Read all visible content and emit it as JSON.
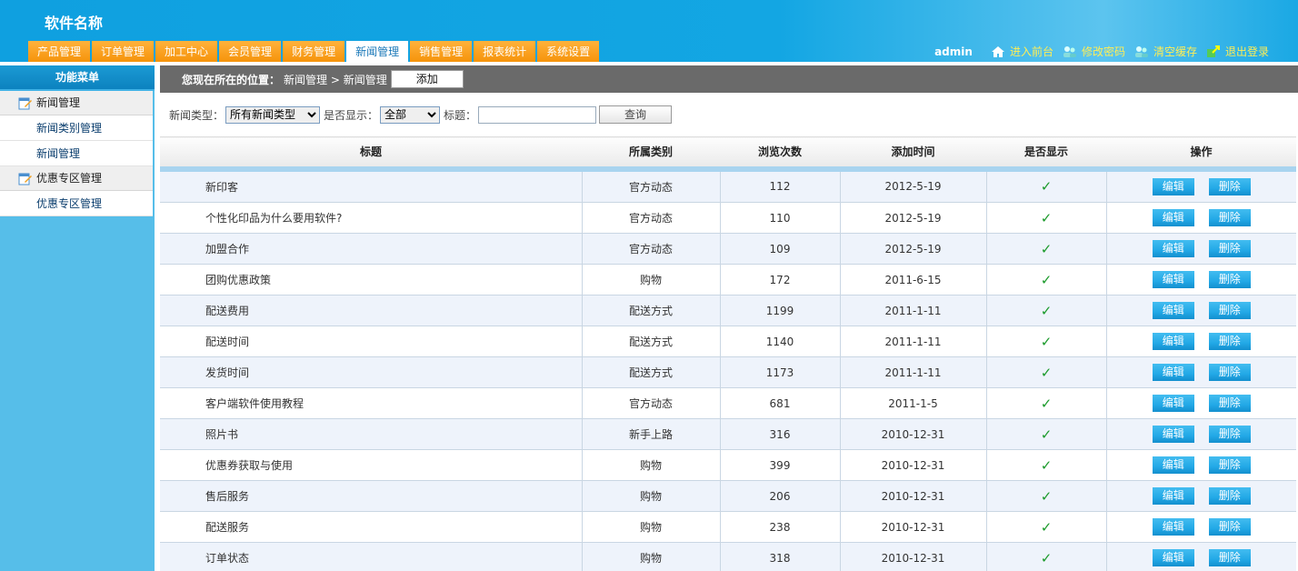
{
  "app": {
    "title": "软件名称"
  },
  "nav": {
    "tabs": [
      {
        "label": "产品管理",
        "active": false
      },
      {
        "label": "订单管理",
        "active": false
      },
      {
        "label": "加工中心",
        "active": false
      },
      {
        "label": "会员管理",
        "active": false
      },
      {
        "label": "财务管理",
        "active": false
      },
      {
        "label": "新闻管理",
        "active": true
      },
      {
        "label": "销售管理",
        "active": false
      },
      {
        "label": "报表统计",
        "active": false
      },
      {
        "label": "系统设置",
        "active": false
      }
    ]
  },
  "toolbar": {
    "user": "admin",
    "front": "进入前台",
    "change_password": "修改密码",
    "clear_cache": "清空缓存",
    "logout": "退出登录"
  },
  "sidebar": {
    "header": "功能菜单",
    "groups": [
      {
        "label": "新闻管理",
        "items": [
          "新闻类别管理",
          "新闻管理"
        ]
      },
      {
        "label": "优惠专区管理",
        "items": [
          "优惠专区管理"
        ]
      }
    ]
  },
  "main": {
    "crumb_prefix": "您现在所在的位置：",
    "crumb_path": "新闻管理 > 新闻管理",
    "add_label": "添加"
  },
  "filter": {
    "type_label": "新闻类型：",
    "type_value": "所有新闻类型",
    "show_label": "是否显示：",
    "show_value": "全部",
    "title_label": "标题：",
    "title_value": "",
    "query_label": "查询"
  },
  "table": {
    "headers": [
      "标题",
      "所属类别",
      "浏览次数",
      "添加时间",
      "是否显示",
      "操作"
    ],
    "edit_label": "编辑",
    "delete_label": "删除",
    "rows": [
      {
        "title": "新印客",
        "category": "官方动态",
        "views": "112",
        "date": "2012-5-19",
        "shown": "✓"
      },
      {
        "title": "个性化印品为什么要用软件?",
        "category": "官方动态",
        "views": "110",
        "date": "2012-5-19",
        "shown": "✓"
      },
      {
        "title": "加盟合作",
        "category": "官方动态",
        "views": "109",
        "date": "2012-5-19",
        "shown": "✓"
      },
      {
        "title": "团购优惠政策",
        "category": "购物",
        "views": "172",
        "date": "2011-6-15",
        "shown": "✓"
      },
      {
        "title": "配送费用",
        "category": "配送方式",
        "views": "1199",
        "date": "2011-1-11",
        "shown": "✓"
      },
      {
        "title": "配送时间",
        "category": "配送方式",
        "views": "1140",
        "date": "2011-1-11",
        "shown": "✓"
      },
      {
        "title": "发货时间",
        "category": "配送方式",
        "views": "1173",
        "date": "2011-1-11",
        "shown": "✓"
      },
      {
        "title": "客户端软件使用教程",
        "category": "官方动态",
        "views": "681",
        "date": "2011-1-5",
        "shown": "✓"
      },
      {
        "title": "照片书",
        "category": "新手上路",
        "views": "316",
        "date": "2010-12-31",
        "shown": "✓"
      },
      {
        "title": "优惠券获取与使用",
        "category": "购物",
        "views": "399",
        "date": "2010-12-31",
        "shown": "✓"
      },
      {
        "title": "售后服务",
        "category": "购物",
        "views": "206",
        "date": "2010-12-31",
        "shown": "✓"
      },
      {
        "title": "配送服务",
        "category": "购物",
        "views": "238",
        "date": "2010-12-31",
        "shown": "✓"
      },
      {
        "title": "订单状态",
        "category": "购物",
        "views": "318",
        "date": "2010-12-31",
        "shown": "✓"
      }
    ]
  },
  "colors": {
    "brand": "#13a6e3",
    "tab": "#f59208",
    "sidebar": "#56bee9",
    "check": "#1a9a2a"
  }
}
